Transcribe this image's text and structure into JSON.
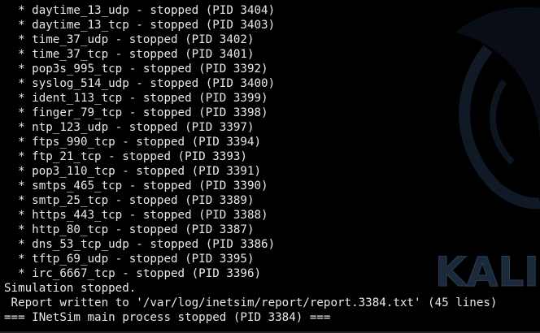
{
  "terminal": {
    "lines": [
      "  * daytime_13_udp - stopped (PID 3404)",
      "  * daytime_13_tcp - stopped (PID 3403)",
      "  * time_37_udp - stopped (PID 3402)",
      "  * time_37_tcp - stopped (PID 3401)",
      "  * pop3s_995_tcp - stopped (PID 3392)",
      "  * syslog_514_udp - stopped (PID 3400)",
      "  * ident_113_tcp - stopped (PID 3399)",
      "  * finger_79_tcp - stopped (PID 3398)",
      "  * ntp_123_udp - stopped (PID 3397)",
      "  * ftps_990_tcp - stopped (PID 3394)",
      "  * ftp_21_tcp - stopped (PID 3393)",
      "  * pop3_110_tcp - stopped (PID 3391)",
      "  * smtps_465_tcp - stopped (PID 3390)",
      "  * smtp_25_tcp - stopped (PID 3389)",
      "  * https_443_tcp - stopped (PID 3388)",
      "  * http_80_tcp - stopped (PID 3387)",
      "  * dns_53_tcp_udp - stopped (PID 3386)",
      "  * tftp_69_udp - stopped (PID 3395)",
      "  * irc_6667_tcp - stopped (PID 3396)",
      "Simulation stopped.",
      " Report written to '/var/log/inetsim/report/report.3384.txt' (45 lines)",
      "=== INetSim main process stopped (PID 3384) ==="
    ]
  },
  "wallpaper": {
    "logo_text": "KALI",
    "logo_color": "#1b2a3a"
  },
  "colors": {
    "background": "#000000",
    "text": "#e8e8e8"
  }
}
